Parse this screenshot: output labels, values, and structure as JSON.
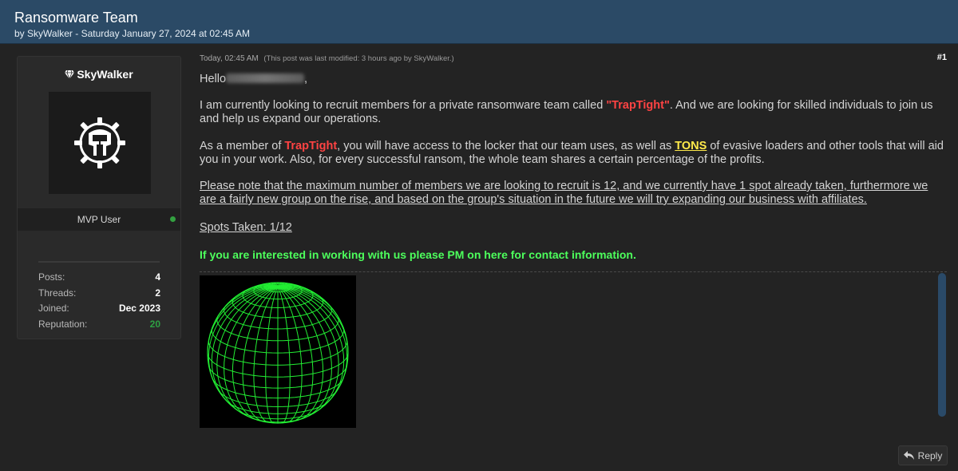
{
  "thread": {
    "title": "Ransomware Team",
    "meta": "by SkyWalker - Saturday January 27, 2024 at 02:45 AM"
  },
  "author": {
    "name": "SkyWalker",
    "rank": "MVP User",
    "stats": [
      {
        "label": "Posts:",
        "value": "4"
      },
      {
        "label": "Threads:",
        "value": "2"
      },
      {
        "label": "Joined:",
        "value": "Dec 2023"
      },
      {
        "label": "Reputation:",
        "value": "20"
      }
    ],
    "colors": {
      "online": "#33a040",
      "reputation": "#2ea043"
    }
  },
  "post": {
    "time": "Today, 02:45 AM",
    "modified": "(This post was last modified: 3 hours ago by SkyWalker.)",
    "number": "#1",
    "greeting": "Hello",
    "greeting_tail": ",",
    "p1_a": "I am currently looking to recruit members for a private ransomware team called ",
    "p1_team": "\"TrapTight\"",
    "p1_b": ". And we are looking for skilled individuals to join us and help us expand our operations.",
    "p2_a": "As a member of ",
    "p2_team": "TrapTight",
    "p2_b": ", you will have access to the locker that our team uses, as well as ",
    "p2_tons": "TONS",
    "p2_c": " of evasive loaders and other tools that will aid you in your work. Also, for every successful ransom, the whole team shares a certain percentage of the profits.",
    "p3": "Please note that the maximum number of members we are looking to recruit is 12, and we currently have 1 spot already taken, furthermore we are a fairly new group on the rise, and based on the group's situation in the future we will try expanding our business with affiliates.",
    "p4": "Spots Taken: 1/12",
    "p5": "If you are interested in working with us please PM on here for contact information.",
    "colors": {
      "team": "#ff4343",
      "tons": "#ffea4a",
      "contact": "#4dff5c",
      "globe": "#22ee33"
    }
  },
  "actions": {
    "reply_label": "Reply"
  }
}
